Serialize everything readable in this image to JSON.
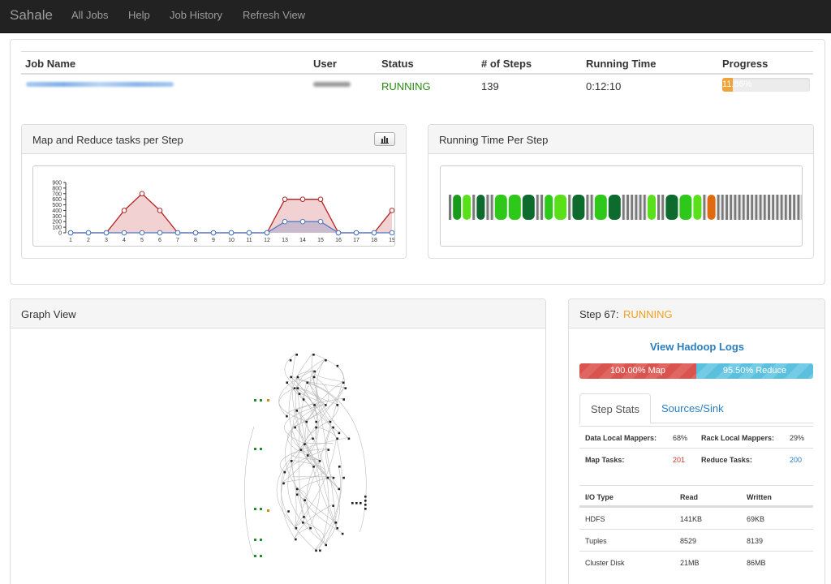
{
  "navbar": {
    "brand": "Sahale",
    "links": [
      "All Jobs",
      "Help",
      "Job History",
      "Refresh View"
    ]
  },
  "job_table": {
    "headers": [
      "Job Name",
      "User",
      "Status",
      "# of Steps",
      "Running Time",
      "Progress"
    ],
    "row": {
      "status": "RUNNING",
      "steps": "139",
      "running_time": "0:12:10",
      "progress_label": "11.86%",
      "progress_fraction": 0.1186
    }
  },
  "map_reduce_panel": {
    "title": "Map and Reduce tasks per Step",
    "button_icon": "bar-chart-icon"
  },
  "running_time_panel": {
    "title": "Running Time Per Step"
  },
  "graph_panel": {
    "title": "Graph View"
  },
  "step_panel": {
    "step_label": "Step 67:",
    "step_status": "RUNNING",
    "hadoop_link": "View Hadoop Logs",
    "map_label": "100.00% Map",
    "reduce_label": "95.50% Reduce",
    "map_fraction": 1.0,
    "reduce_fraction": 0.955,
    "tabs": [
      "Step Stats",
      "Sources/Sink"
    ],
    "stats": {
      "data_local_label": "Data Local Mappers:",
      "data_local_value": "68%",
      "rack_local_label": "Rack Local Mappers:",
      "rack_local_value": "29%",
      "map_tasks_label": "Map Tasks:",
      "map_tasks_value": "201",
      "reduce_tasks_label": "Reduce Tasks:",
      "reduce_tasks_value": "200"
    },
    "io_table": {
      "headers": [
        "I/O Type",
        "Read",
        "Written"
      ],
      "rows": [
        [
          "HDFS",
          "141KB",
          "69KB"
        ],
        [
          "Tuples",
          "8529",
          "8139"
        ],
        [
          "Cluster Disk",
          "21MB",
          "86MB"
        ]
      ]
    }
  },
  "colors": {
    "navbar": "#222222",
    "running": "#2a8a12",
    "step_running": "#f0a020",
    "progress": "#f0a33a",
    "map_series": "#b22222",
    "reduce_series": "#4a78c0",
    "link": "#2a7ec0"
  },
  "chart_data": [
    {
      "type": "area",
      "x": [
        1,
        2,
        3,
        4,
        5,
        6,
        7,
        8,
        9,
        10,
        11,
        12,
        13,
        14,
        15,
        16,
        17,
        18,
        19
      ],
      "yticks": [
        0,
        100,
        200,
        300,
        400,
        500,
        600,
        700,
        800,
        900
      ],
      "ylim": [
        0,
        900
      ],
      "series": [
        {
          "values": [
            0,
            0,
            0,
            400,
            700,
            400,
            0,
            0,
            0,
            0,
            0,
            0,
            600,
            600,
            600,
            0,
            0,
            0,
            400
          ]
        },
        {
          "values": [
            0,
            0,
            0,
            0,
            0,
            0,
            0,
            0,
            0,
            0,
            0,
            0,
            200,
            200,
            200,
            0,
            0,
            0,
            0
          ]
        }
      ]
    },
    {
      "type": "bar",
      "note": "step bars",
      "bars": [
        {
          "w": "thin",
          "c": "#7a7a7a"
        },
        {
          "w": "med",
          "c": "#1a9a1a"
        },
        {
          "w": "med",
          "c": "#5ae01a"
        },
        {
          "w": "thin",
          "c": "#7a7a7a"
        },
        {
          "w": "med",
          "c": "#0e6b2e"
        },
        {
          "w": "thin",
          "c": "#7a7a7a"
        },
        {
          "w": "thin",
          "c": "#7a7a7a"
        },
        {
          "w": "wide",
          "c": "#2ec81a"
        },
        {
          "w": "wide",
          "c": "#2ec81a"
        },
        {
          "w": "wide",
          "c": "#0e6b2e"
        },
        {
          "w": "thin",
          "c": "#7a7a7a"
        },
        {
          "w": "thin",
          "c": "#7a7a7a"
        },
        {
          "w": "med",
          "c": "#2ec81a"
        },
        {
          "w": "wide",
          "c": "#5ae01a"
        },
        {
          "w": "thin",
          "c": "#7a7a7a"
        },
        {
          "w": "wide",
          "c": "#0e6b2e"
        },
        {
          "w": "thin",
          "c": "#7a7a7a"
        },
        {
          "w": "thin",
          "c": "#7a7a7a"
        },
        {
          "w": "wide",
          "c": "#2ec81a"
        },
        {
          "w": "wide",
          "c": "#0e6b2e"
        },
        {
          "w": "thin",
          "c": "#7a7a7a"
        },
        {
          "w": "thin",
          "c": "#7a7a7a"
        },
        {
          "w": "thin",
          "c": "#7a7a7a"
        },
        {
          "w": "thin",
          "c": "#7a7a7a"
        },
        {
          "w": "thin",
          "c": "#7a7a7a"
        },
        {
          "w": "thin",
          "c": "#7a7a7a"
        },
        {
          "w": "med",
          "c": "#5ae01a"
        },
        {
          "w": "thin",
          "c": "#7a7a7a"
        },
        {
          "w": "thin",
          "c": "#7a7a7a"
        },
        {
          "w": "wide",
          "c": "#0e6b2e"
        },
        {
          "w": "wide",
          "c": "#2ec81a"
        },
        {
          "w": "med",
          "c": "#5ae01a"
        },
        {
          "w": "thin",
          "c": "#7a7a7a"
        },
        {
          "w": "med",
          "c": "#e06a10"
        },
        {
          "w": "thin",
          "c": "#7a7a7a"
        },
        {
          "w": "thin",
          "c": "#7a7a7a"
        },
        {
          "w": "thin",
          "c": "#7a7a7a"
        },
        {
          "w": "thin",
          "c": "#7a7a7a"
        },
        {
          "w": "thin",
          "c": "#7a7a7a"
        },
        {
          "w": "thin",
          "c": "#7a7a7a"
        },
        {
          "w": "thin",
          "c": "#7a7a7a"
        },
        {
          "w": "thin",
          "c": "#7a7a7a"
        },
        {
          "w": "thin",
          "c": "#7a7a7a"
        },
        {
          "w": "thin",
          "c": "#7a7a7a"
        },
        {
          "w": "thin",
          "c": "#7a7a7a"
        },
        {
          "w": "thin",
          "c": "#7a7a7a"
        },
        {
          "w": "thin",
          "c": "#7a7a7a"
        },
        {
          "w": "thin",
          "c": "#7a7a7a"
        },
        {
          "w": "thin",
          "c": "#7a7a7a"
        },
        {
          "w": "thin",
          "c": "#7a7a7a"
        },
        {
          "w": "thin",
          "c": "#7a7a7a"
        },
        {
          "w": "thin",
          "c": "#7a7a7a"
        },
        {
          "w": "thin",
          "c": "#7a7a7a"
        },
        {
          "w": "thin",
          "c": "#7a7a7a"
        },
        {
          "w": "thin",
          "c": "#7a7a7a"
        },
        {
          "w": "thin",
          "c": "#7a7a7a"
        },
        {
          "w": "thin",
          "c": "#7a7a7a"
        },
        {
          "w": "thin",
          "c": "#7a7a7a"
        },
        {
          "w": "thin",
          "c": "#7a7a7a"
        },
        {
          "w": "thin",
          "c": "#7a7a7a"
        }
      ]
    }
  ]
}
